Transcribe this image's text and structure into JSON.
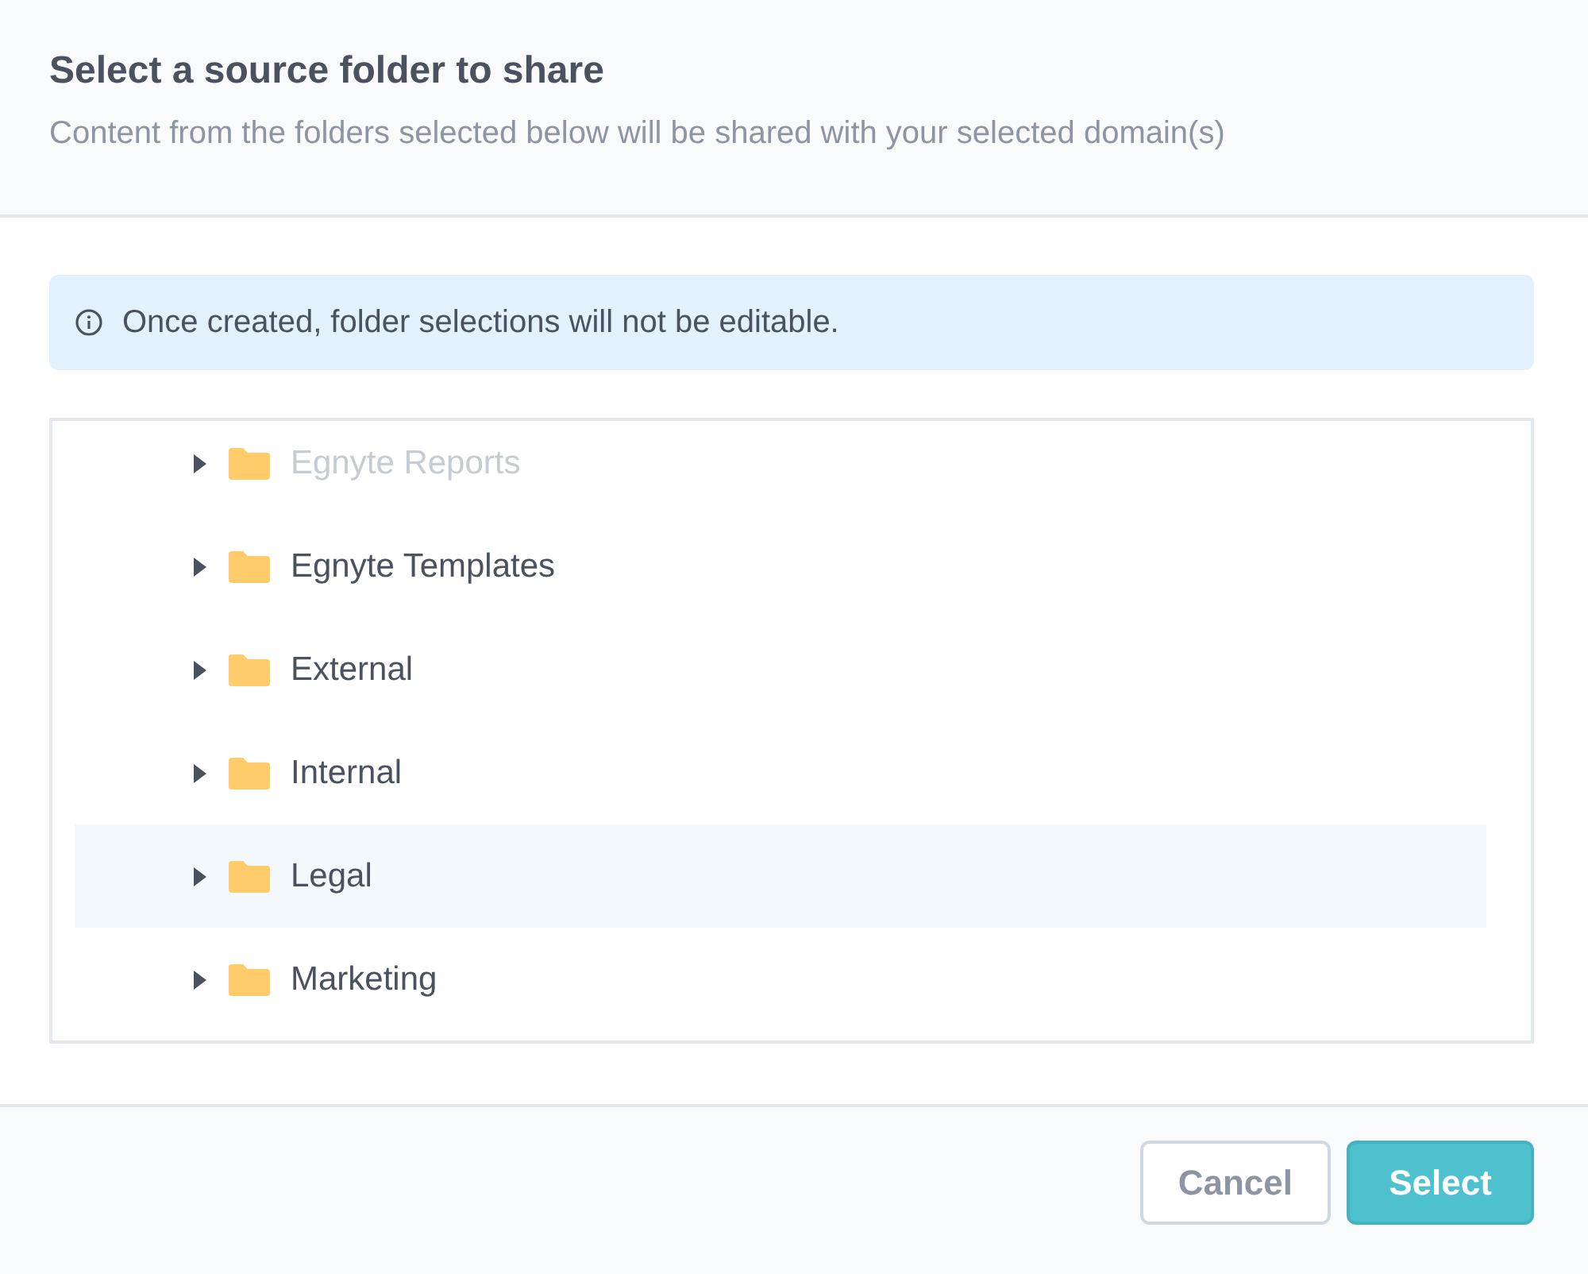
{
  "dialog": {
    "title": "Select a source folder to share",
    "subtitle": "Content from the folders selected below will be shared with your selected domain(s)"
  },
  "notice": {
    "text": "Once created, folder selections will not be editable."
  },
  "folders": [
    {
      "name": "Egnyte Reports",
      "disabled": true,
      "selected": false,
      "expanded": false
    },
    {
      "name": "Egnyte Templates",
      "disabled": false,
      "selected": false,
      "expanded": false
    },
    {
      "name": "External",
      "disabled": false,
      "selected": false,
      "expanded": false
    },
    {
      "name": "Internal",
      "disabled": false,
      "selected": false,
      "expanded": false
    },
    {
      "name": "Legal",
      "disabled": false,
      "selected": true,
      "expanded": false
    },
    {
      "name": "Marketing",
      "disabled": false,
      "selected": false,
      "expanded": false
    }
  ],
  "buttons": [
    {
      "label": "Cancel",
      "kind": "secondary"
    },
    {
      "label": "Select",
      "kind": "primary"
    }
  ]
}
